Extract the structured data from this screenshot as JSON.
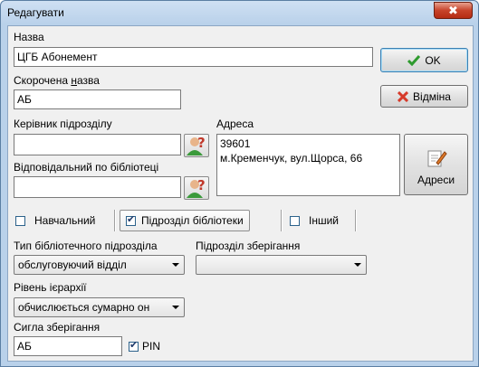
{
  "window": {
    "title": "Редагувати",
    "close_label": "✖"
  },
  "fields": {
    "name_label": "Назва",
    "name_value": "ЦГБ Абонемент",
    "short_label": "Скорочена назва",
    "short_value": "АБ",
    "head_label": "Керівник підрозділу",
    "head_value": "",
    "responsible_label": "Відповідальний по бібліотеці",
    "responsible_value": "",
    "address_label": "Адреса",
    "address_value": "39601\nм.Кременчук, вул.Щорса, 66"
  },
  "buttons": {
    "ok": "OK",
    "cancel": "Відміна",
    "addresses": "Адреси"
  },
  "tabs": [
    {
      "label": "Навчальний",
      "checked": false
    },
    {
      "label": "Підрозділ бібліотеки",
      "checked": true
    },
    {
      "label": "Інший",
      "checked": false
    }
  ],
  "library": {
    "type_label": "Тип бібліотечного підрозділа",
    "type_value": "обслуговуючий відділ",
    "storage_label": "Підрозділ зберігання",
    "storage_value": "",
    "level_label": "Рівень ієрархії",
    "level_value": "обчислюється сумарно он",
    "sigla_label": "Сигла зберігання",
    "sigla_value": "АБ",
    "pin_label": "PIN",
    "pin_checked": true
  },
  "colors": {
    "ok_check": "#2e9a2e",
    "cancel_x": "#d63a2a",
    "frame": "#b9d1ea"
  }
}
